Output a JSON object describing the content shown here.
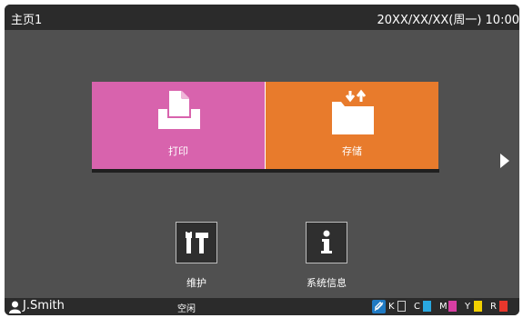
{
  "header": {
    "title": "主页1",
    "datetime": "20XX/XX/XX(周一) 10:00"
  },
  "tiles": {
    "print": {
      "label": "打印",
      "color": "#d863ad"
    },
    "storage": {
      "label": "存储",
      "color": "#e87b2c"
    }
  },
  "tools": {
    "maintenance": {
      "label": "维护",
      "icon": "tools-icon"
    },
    "system_info": {
      "label": "系统信息",
      "icon": "info-icon"
    }
  },
  "status_bar": {
    "user": "J.Smith",
    "status": "空闲",
    "inks": [
      {
        "letter": "K",
        "color": "#2b2b2b"
      },
      {
        "letter": "C",
        "color": "#29a8e0"
      },
      {
        "letter": "M",
        "color": "#d83ea3"
      },
      {
        "letter": "Y",
        "color": "#f2d000"
      },
      {
        "letter": "R",
        "color": "#e8372c"
      }
    ]
  }
}
